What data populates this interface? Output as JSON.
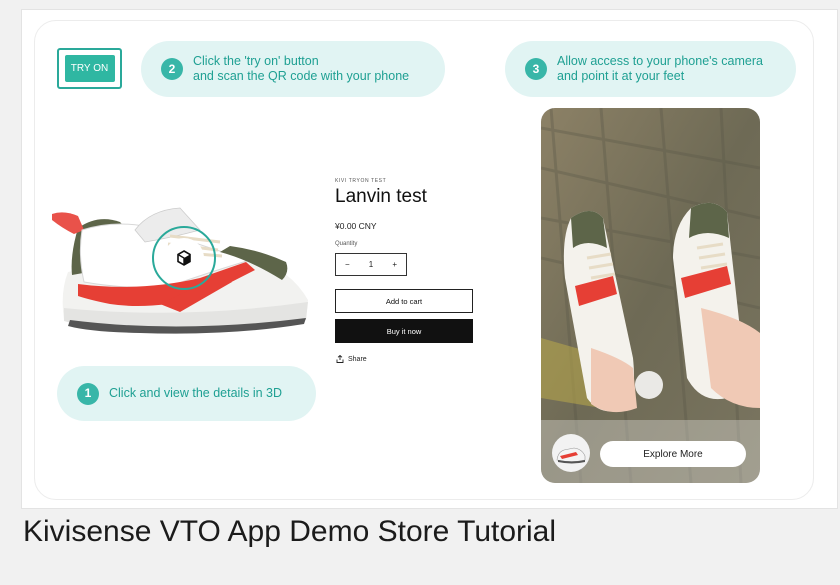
{
  "steps": {
    "try_on_button": "TRY ON",
    "step1": {
      "number": "1",
      "text": "Click and view the details in 3D"
    },
    "step2": {
      "number": "2",
      "line1": "Click the 'try on' button",
      "line2": "and scan the QR code with your phone"
    },
    "step3": {
      "number": "3",
      "line1": "Allow access to your phone's camera",
      "line2": "and point it at your feet"
    }
  },
  "product": {
    "store_name": "KIVI TRYON TEST",
    "title": "Lanvin test",
    "price": "¥0.00 CNY",
    "quantity_label": "Quantity",
    "quantity_value": "1",
    "minus": "−",
    "plus": "+",
    "add_to_cart": "Add to cart",
    "buy_now": "Buy it now",
    "share": "Share"
  },
  "phone": {
    "explore_button": "Explore More"
  },
  "caption": "Kivisense VTO App Demo Store Tutorial",
  "colors": {
    "accent": "#2fb7a2",
    "pill_bg": "#e1f4f3",
    "step_text": "#1fa093"
  },
  "icons": [
    "cube-3d-icon",
    "share-icon"
  ]
}
